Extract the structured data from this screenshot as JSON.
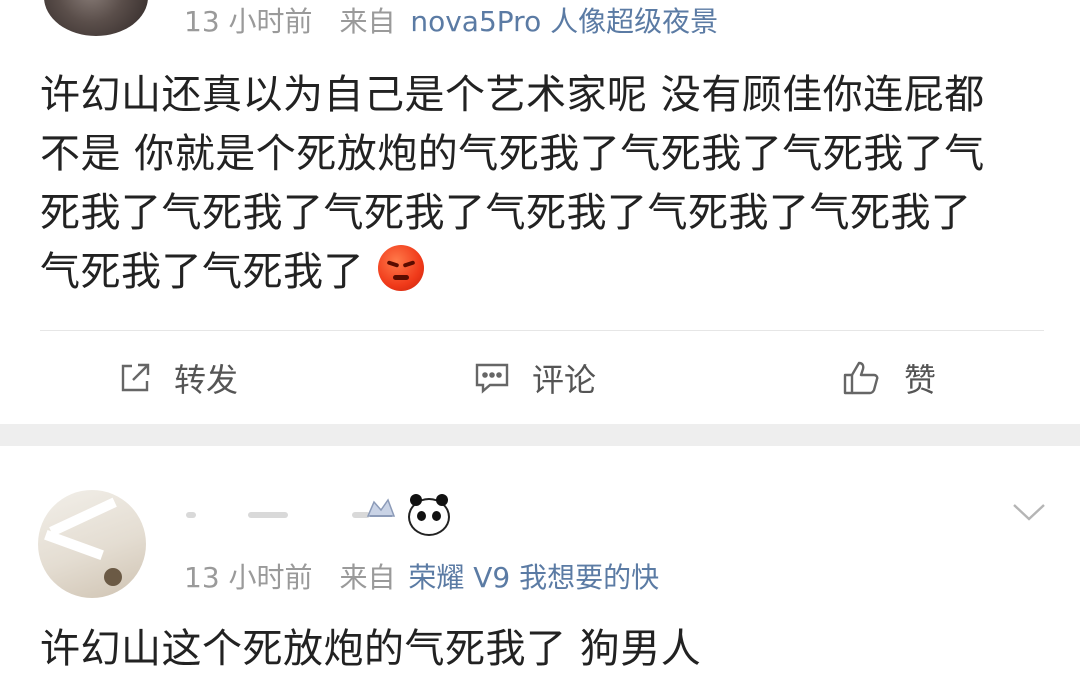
{
  "post1": {
    "time": "13 小时前",
    "from_prefix": "来自",
    "device": "nova5Pro 人像超级夜景",
    "lines": [
      "许幻山还真以为自己是个艺术家呢 没有顾佳你连屁都",
      "不是 你就是个死放炮的气死我了气死我了气死我了气",
      "死我了气死我了气死我了气死我了气死我了气死我了",
      "气死我了气死我了"
    ],
    "emoji": "angry-face-icon"
  },
  "actions": {
    "repost": "转发",
    "comment": "评论",
    "like": "赞"
  },
  "post2": {
    "time": "13 小时前",
    "from_prefix": "来自",
    "device": "荣耀 V9 我想要的快",
    "text": "许幻山这个死放炮的气死我了 狗男人"
  },
  "colors": {
    "meta_gray": "#9a9a9a",
    "source_blue": "#5b7ba4",
    "text_dark": "#222222",
    "separator": "#eeeeee"
  }
}
